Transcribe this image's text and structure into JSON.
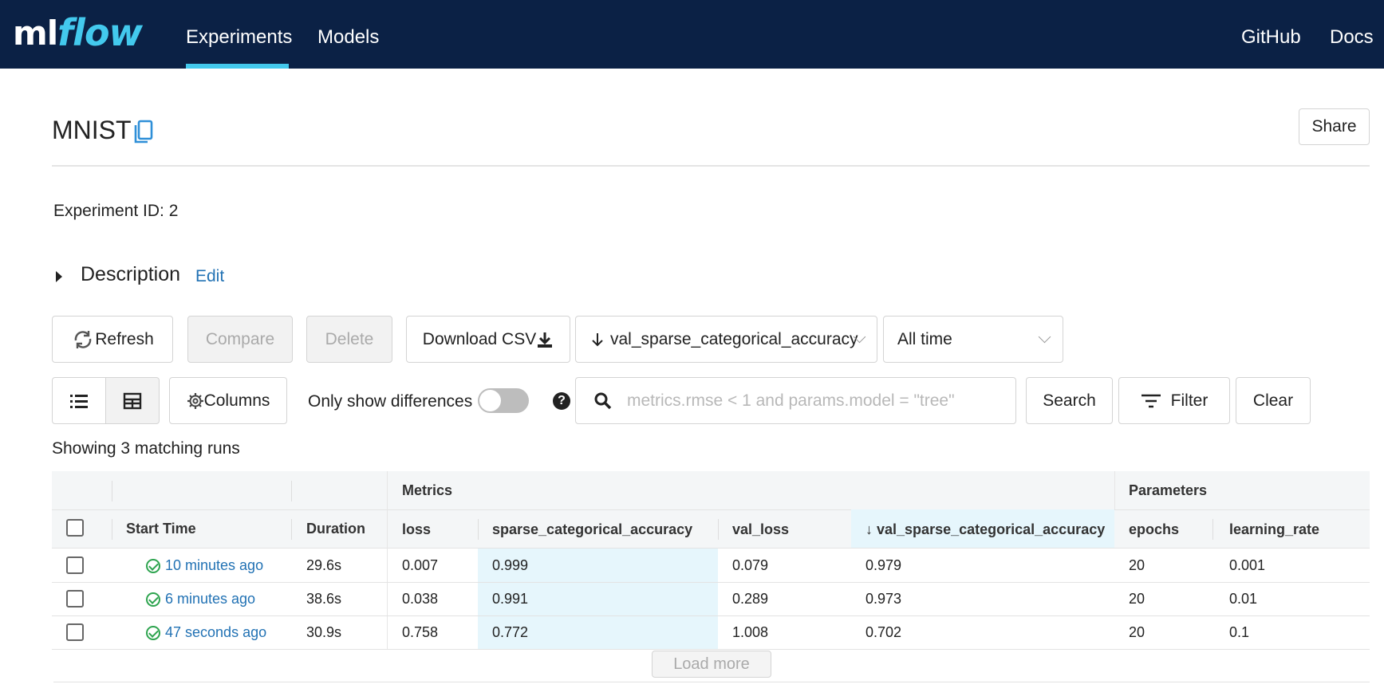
{
  "nav": {
    "logo_ml": "ml",
    "logo_flow": "flow",
    "experiments": "Experiments",
    "models": "Models",
    "github": "GitHub",
    "docs": "Docs",
    "active_tab": "Experiments",
    "accent_color": "#43c9ed",
    "bg_color": "#0b2145"
  },
  "header": {
    "title": "MNIST",
    "share": "Share",
    "experiment_id_label": "Experiment ID:",
    "experiment_id": "2",
    "description": "Description",
    "edit": "Edit"
  },
  "toolbar": {
    "refresh": "Refresh",
    "compare": "Compare",
    "delete": "Delete",
    "download_csv": "Download CSV",
    "sort_by": "val_sparse_categorical_accuracy",
    "time_range": "All time",
    "columns": "Columns",
    "only_show_differences": "Only show differences",
    "search_placeholder": "metrics.rmse < 1 and params.model = \"tree\"",
    "search": "Search",
    "filter": "Filter",
    "clear": "Clear"
  },
  "table": {
    "showing": "Showing 3 matching runs",
    "group_headers": {
      "metrics": "Metrics",
      "parameters": "Parameters"
    },
    "columns": [
      "Start Time",
      "Duration",
      "loss",
      "sparse_categorical_accuracy",
      "val_loss",
      "val_sparse_categorical_accuracy",
      "epochs",
      "learning_rate"
    ],
    "sorted_column": "val_sparse_categorical_accuracy",
    "rows": [
      {
        "start_time": "10 minutes ago",
        "duration": "29.6s",
        "loss": "0.007",
        "sca": "0.999",
        "val_loss": "0.079",
        "val_sca": "0.979",
        "epochs": "20",
        "learning_rate": "0.001"
      },
      {
        "start_time": "6 minutes ago",
        "duration": "38.6s",
        "loss": "0.038",
        "sca": "0.991",
        "val_loss": "0.289",
        "val_sca": "0.973",
        "epochs": "20",
        "learning_rate": "0.01"
      },
      {
        "start_time": "47 seconds ago",
        "duration": "30.9s",
        "loss": "0.758",
        "sca": "0.772",
        "val_loss": "1.008",
        "val_sca": "0.702",
        "epochs": "20",
        "learning_rate": "0.1"
      }
    ],
    "load_more": "Load more"
  }
}
